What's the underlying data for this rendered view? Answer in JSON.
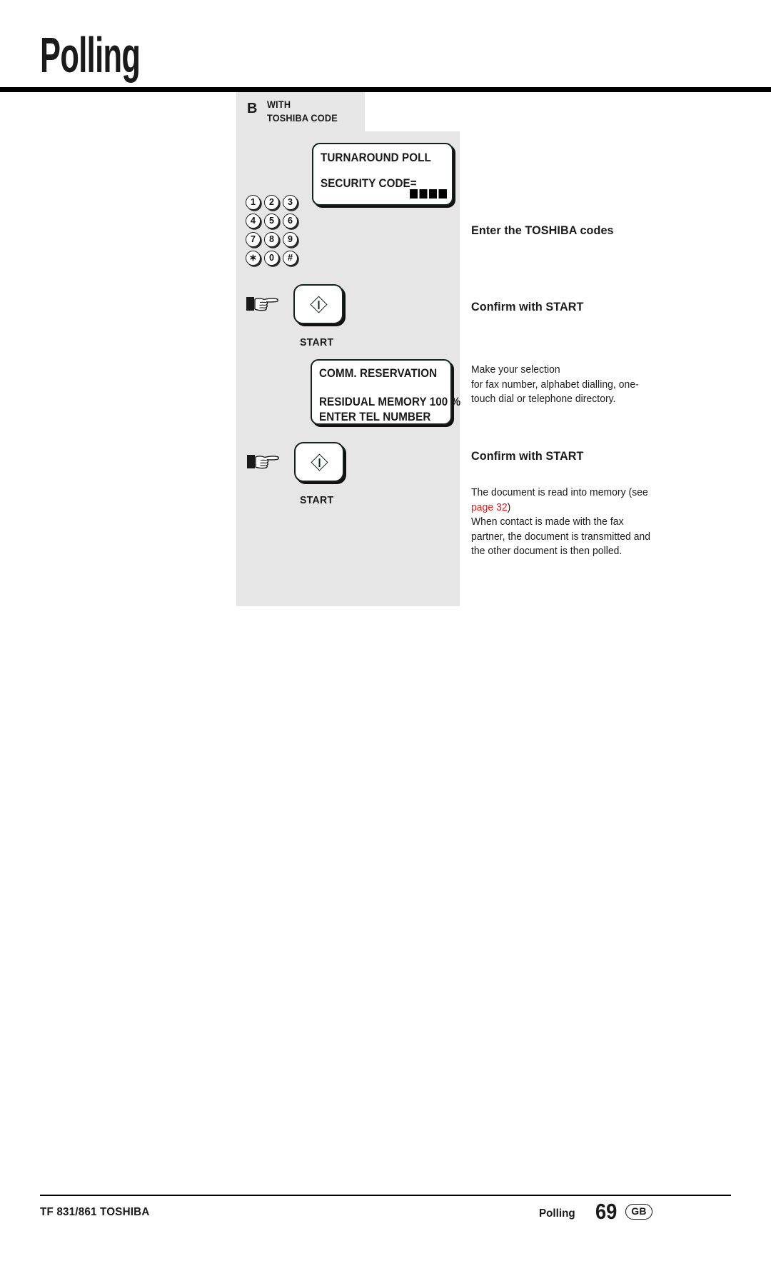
{
  "document": {
    "title": "Polling"
  },
  "section": {
    "letter": "B",
    "title_line_1": "WITH",
    "title_line_2": "TOSHIBA CODE"
  },
  "lcd_displays": [
    {
      "name": "turnaround-poll-display",
      "line_1": "TURNAROUND POLL",
      "line_2": "SECURITY CODE=",
      "cursor_blocks": 4
    },
    {
      "name": "comm-reservation-display",
      "line_1": "COMM. RESERVATION",
      "line_2": "RESIDUAL MEMORY 100 %",
      "line_3": "ENTER TEL NUMBER"
    }
  ],
  "keypad": {
    "rows": [
      [
        "1",
        "2",
        "3"
      ],
      [
        "4",
        "5",
        "6"
      ],
      [
        "7",
        "8",
        "9"
      ],
      [
        "∗",
        "0",
        "#"
      ]
    ]
  },
  "buttons": {
    "start_label": "START"
  },
  "instructions": [
    {
      "heading": "Enter the TOSHIBA codes"
    },
    {
      "heading": "Confirm with START"
    },
    {
      "body_line_1": "Make your selection",
      "body_line_2": "for fax number, alphabet dialling, one-",
      "body_line_3": "touch dial or telephone directory."
    },
    {
      "heading": "Confirm with START"
    },
    {
      "body_before_link": "The document is read into memory (see",
      "link_text": "page 32",
      "body_after_link": ")",
      "body_line_2": "When contact is made with the fax",
      "body_line_3": "partner, the document is transmitted and",
      "body_line_4": "the other document is then polled."
    }
  ],
  "footer": {
    "model": "TF 831/861 TOSHIBA",
    "section_name": "Polling",
    "page_number": "69",
    "locale": "GB"
  },
  "colors": {
    "panel_background": "#e6e6e6",
    "link_red": "#e21b13",
    "ink": "#1a1a1a",
    "lcd_border": "#12221f"
  }
}
